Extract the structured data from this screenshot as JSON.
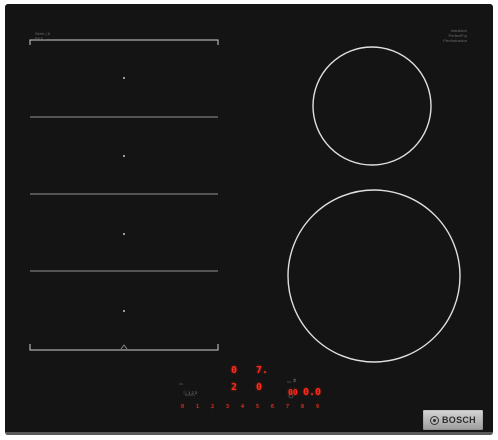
{
  "brand": {
    "left_label": "Serie | 8",
    "left_sub": "PXX...",
    "right_label": "Induktion",
    "right_sub": "PerfectFry",
    "right_sub2": "FlexInduction"
  },
  "logo": {
    "text": "BOSCH"
  },
  "display": {
    "zone_top_left": "0",
    "zone_top_right": "7.",
    "zone_bottom_left": "2",
    "zone_bottom_right": "0",
    "timer_value": "0.0",
    "timer_prefix": "00",
    "slider_values": [
      "0",
      "1",
      "2",
      "3",
      "4",
      "5",
      "6",
      "7",
      "8",
      "9"
    ],
    "left_caption": "ⓘ 1 2 3",
    "right_caption": "⏱"
  },
  "colors": {
    "glass": "#141414",
    "zone_line": "#d9d9d9",
    "led_red": "#ff2a1a",
    "logo_plate": "#c4c4c4"
  }
}
